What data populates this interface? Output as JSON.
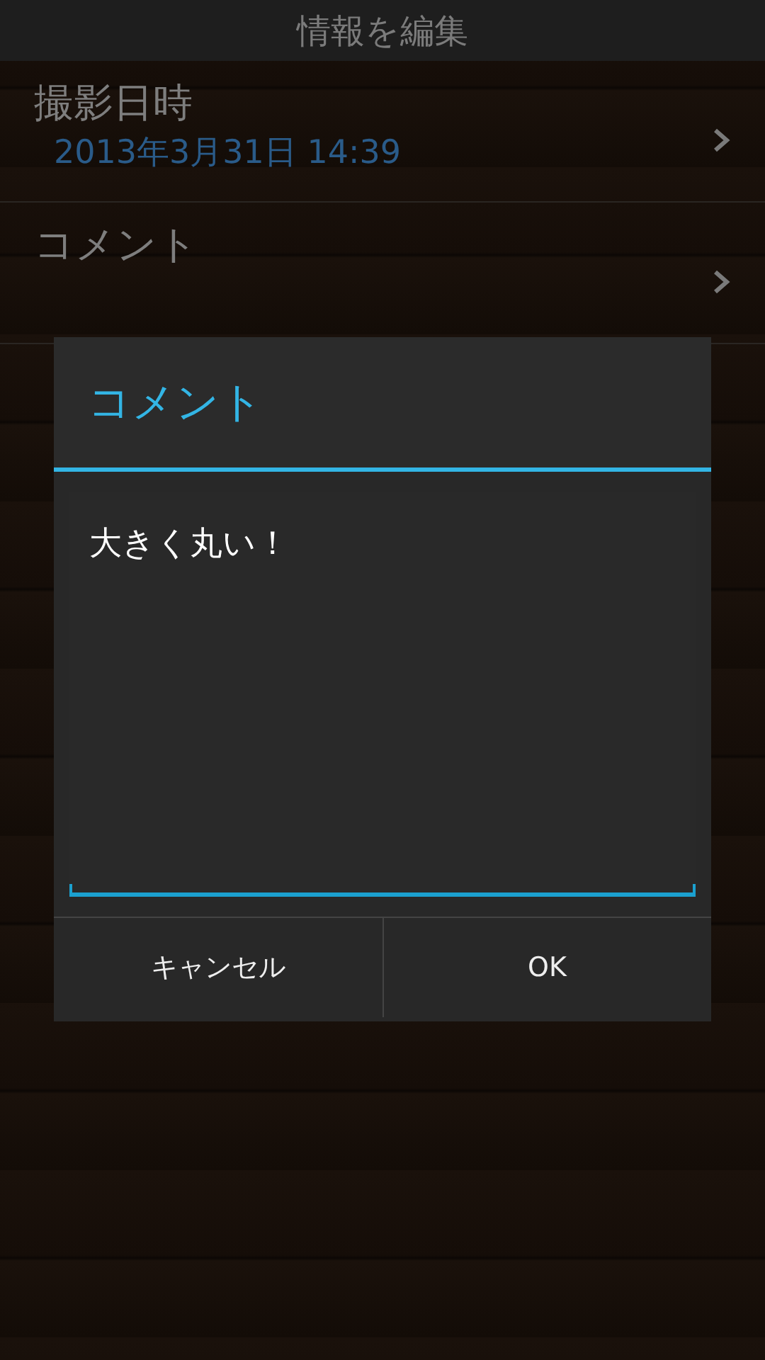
{
  "title_bar": {
    "title": "情報を編集"
  },
  "rows": [
    {
      "label": "撮影日時",
      "value": "2013年3月31日 14:39"
    },
    {
      "label": "コメント"
    }
  ],
  "dialog": {
    "title": "コメント",
    "field": {
      "value": "大きく丸い！"
    },
    "buttons": [
      "キャンセル",
      "OK"
    ]
  }
}
